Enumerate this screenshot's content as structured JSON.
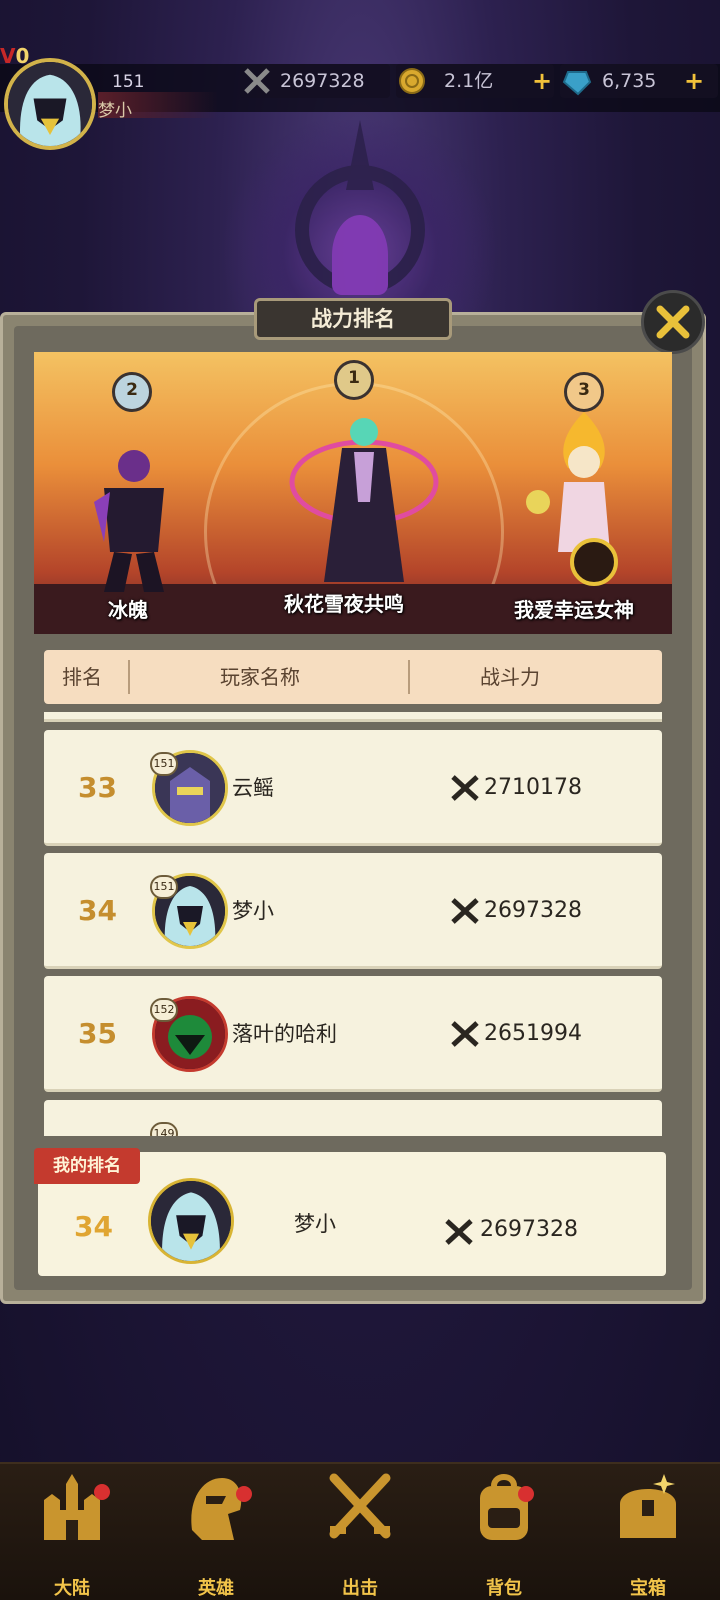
{
  "header": {
    "vip_label": "V",
    "vip_level": "0",
    "player_level": "151",
    "player_name": "梦小",
    "combat_power": "2697328",
    "gold": "2.1亿",
    "gems": "6,735",
    "plus": "+"
  },
  "panel": {
    "title": "战力排名",
    "top3": [
      {
        "rank": "1",
        "name": "秋花雪夜共鸣"
      },
      {
        "rank": "2",
        "name": "冰魄"
      },
      {
        "rank": "3",
        "name": "我爱幸运女神"
      }
    ],
    "columns": {
      "rank": "排名",
      "name": "玩家名称",
      "power": "战斗力"
    },
    "rows": [
      {
        "rank": "33",
        "level": "151",
        "name": "云鳐",
        "power": "2710178"
      },
      {
        "rank": "34",
        "level": "151",
        "name": "梦小",
        "power": "2697328"
      },
      {
        "rank": "35",
        "level": "152",
        "name": "落叶的哈利",
        "power": "2651994"
      },
      {
        "rank": "",
        "level": "149",
        "name": "",
        "power": ""
      }
    ],
    "my_rank": {
      "tag": "我的排名",
      "rank": "34",
      "name": "梦小",
      "power": "2697328"
    }
  },
  "nav": [
    {
      "label": "大陆",
      "icon": "castle-icon"
    },
    {
      "label": "英雄",
      "icon": "helmet-icon"
    },
    {
      "label": "出击",
      "icon": "crossed-swords-icon"
    },
    {
      "label": "背包",
      "icon": "backpack-icon"
    },
    {
      "label": "宝箱",
      "icon": "treasure-chest-icon"
    }
  ],
  "colors": {
    "accent_gold": "#f2c44a",
    "rank_orange": "#c58e2e",
    "my_tag_red": "#c43a2e",
    "row_bg": "#f6f2de"
  }
}
